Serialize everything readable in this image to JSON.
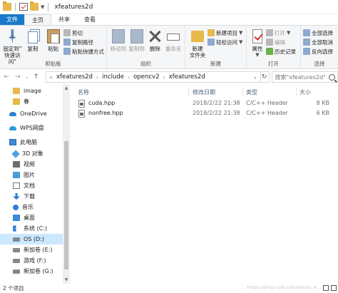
{
  "window": {
    "title": "xfeatures2d"
  },
  "tabs": [
    {
      "label": "文件"
    },
    {
      "label": "主页"
    },
    {
      "label": "共享"
    },
    {
      "label": "查看"
    }
  ],
  "ribbon": {
    "clipboard": {
      "pin_label_1": "固定到\"",
      "pin_label_2": "快速访问\"",
      "copy_label": "复制",
      "paste_label": "粘贴",
      "cut_label": "剪切",
      "copy_path_label": "复制路径",
      "paste_shortcut_label": "粘贴快捷方式",
      "group_label": "剪贴板"
    },
    "organize": {
      "move_to_label": "移动到",
      "copy_to_label": "复制到",
      "delete_label": "删除",
      "rename_label": "重命名",
      "group_label": "组织"
    },
    "new": {
      "new_folder_label_1": "新建",
      "new_folder_label_2": "文件夹",
      "new_item_label": "新建项目",
      "easy_access_label": "轻松访问",
      "group_label": "新建"
    },
    "open": {
      "properties_label": "属性",
      "open_label": "打开",
      "edit_label": "编辑",
      "history_label": "历史记录",
      "group_label": "打开"
    },
    "select": {
      "select_all_label": "全部选择",
      "select_none_label": "全部取消",
      "invert_label": "反向选择",
      "group_label": "选择"
    }
  },
  "address": {
    "crumbs": [
      "xfeatures2d",
      "include",
      "opencv2",
      "xfeatures2d"
    ],
    "search_placeholder": "搜索\"xfeatures2d\""
  },
  "nav": {
    "items": [
      {
        "label": "image",
        "icon": "folder-icon"
      },
      {
        "label": "春",
        "icon": "folder-icon"
      },
      {
        "label": "OneDrive",
        "icon": "cloud-icon"
      },
      {
        "label": "WPS网盘",
        "icon": "cloud-icon"
      },
      {
        "label": "此电脑",
        "icon": "pc-icon"
      },
      {
        "label": "3D 对象",
        "icon": "cube-icon"
      },
      {
        "label": "视频",
        "icon": "video-icon"
      },
      {
        "label": "图片",
        "icon": "picture-icon"
      },
      {
        "label": "文档",
        "icon": "document-icon"
      },
      {
        "label": "下载",
        "icon": "download-icon"
      },
      {
        "label": "音乐",
        "icon": "music-icon"
      },
      {
        "label": "桌面",
        "icon": "desktop-icon"
      },
      {
        "label": "系统 (C:)",
        "icon": "windows-drive-icon"
      },
      {
        "label": "OS (D:)",
        "icon": "drive-icon"
      },
      {
        "label": "新加卷 (E:)",
        "icon": "drive-icon"
      },
      {
        "label": "游戏 (F:)",
        "icon": "drive-icon"
      },
      {
        "label": "新加卷 (G:)",
        "icon": "drive-icon"
      }
    ]
  },
  "filelist": {
    "headers": {
      "name": "名称",
      "date": "修改日期",
      "type": "类型",
      "size": "大小"
    },
    "rows": [
      {
        "name": "cuda.hpp",
        "date": "2018/2/22 21:38",
        "type": "C/C++ Header",
        "size": "8 KB"
      },
      {
        "name": "nonfree.hpp",
        "date": "2018/2/22 21:38",
        "type": "C/C++ Header",
        "size": "6 KB"
      }
    ]
  },
  "status": {
    "count": "2 个项目",
    "watermark": "https://blog.csdn.net/weixin_4..."
  }
}
